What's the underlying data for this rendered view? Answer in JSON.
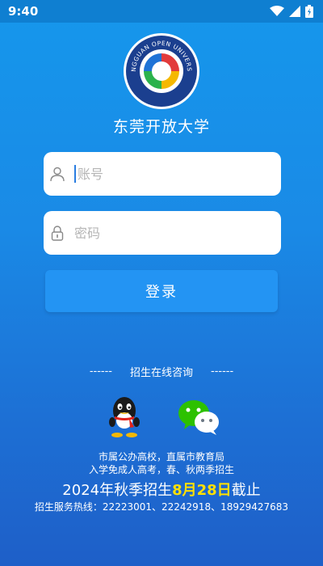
{
  "status_bar": {
    "time": "9:40"
  },
  "app": {
    "title": "东莞开放大学",
    "logo_text": "DONGGUAN OPEN UNIVERSITY"
  },
  "login": {
    "account_placeholder": "账号",
    "password_placeholder": "密码",
    "submit_label": "登录"
  },
  "consult": {
    "dash_left": "------",
    "label": "招生在线咨询",
    "dash_right": "------"
  },
  "info": {
    "line1": "市属公办高校，直属市教育局",
    "line2": "入学免成人高考，春、秋两季招生",
    "line3_prefix": "2024年秋季招生",
    "line3_date": "8月28日",
    "line3_suffix": "截止",
    "line4": "招生服务热线：22223001、22242918、18929427683"
  },
  "colors": {
    "accent": "#2394f3",
    "highlight": "#ffe000"
  }
}
